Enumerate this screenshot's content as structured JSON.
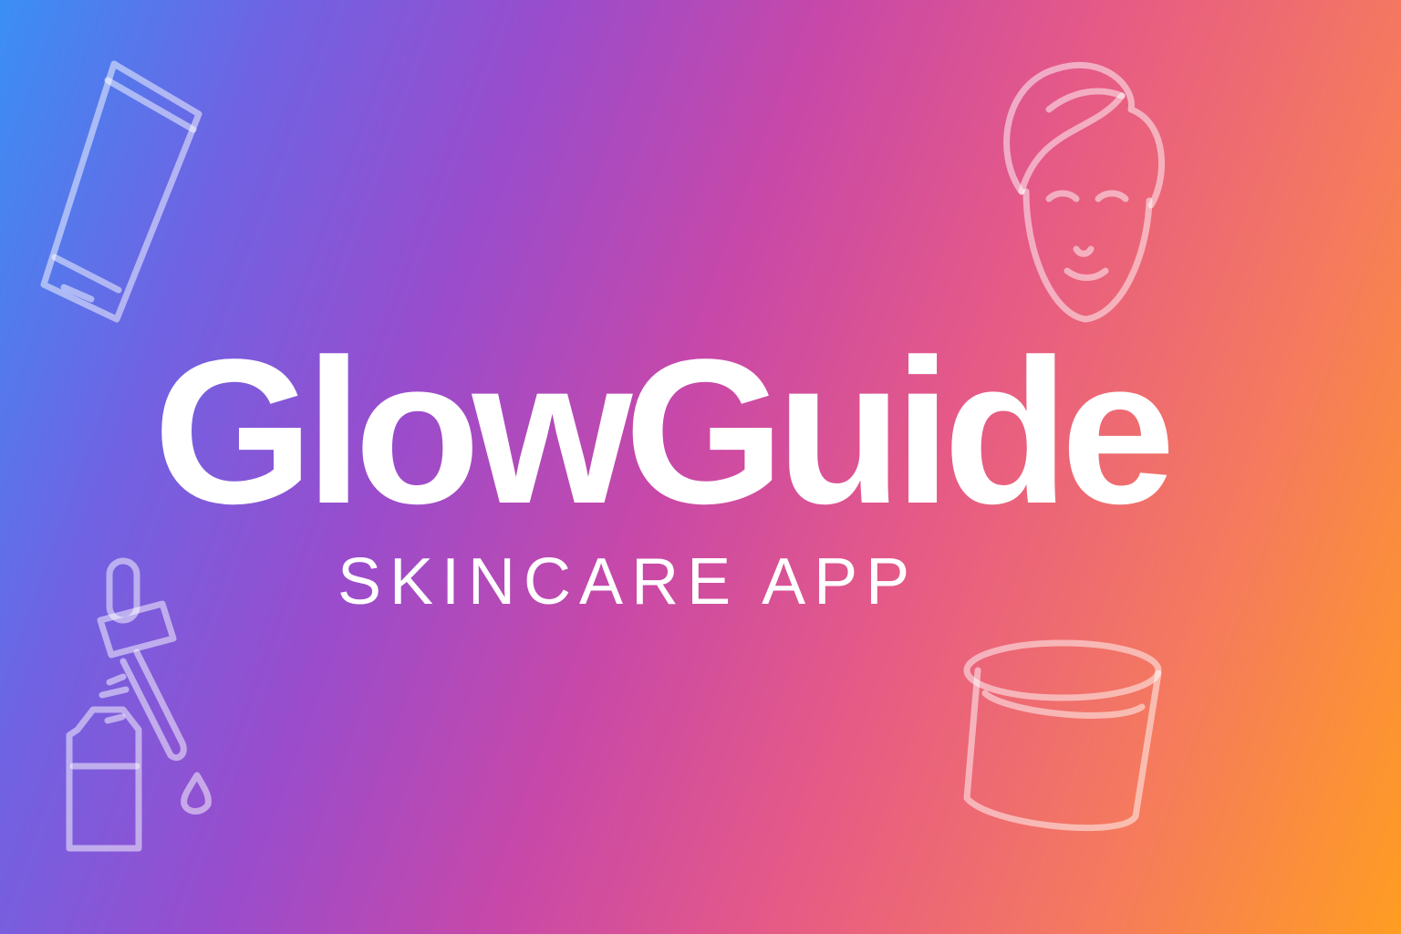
{
  "app": {
    "title": "GlowGuide",
    "subtitle": "SKINCARE APP"
  },
  "decorations": [
    {
      "icon": "tube-icon"
    },
    {
      "icon": "face-towel-icon"
    },
    {
      "icon": "dropper-bottle-icon"
    },
    {
      "icon": "cream-jar-icon"
    }
  ],
  "colors": {
    "gradient_start": "#3a8ff5",
    "gradient_mid": "#c848a8",
    "gradient_end": "#ff9d22",
    "text": "#ffffff"
  }
}
